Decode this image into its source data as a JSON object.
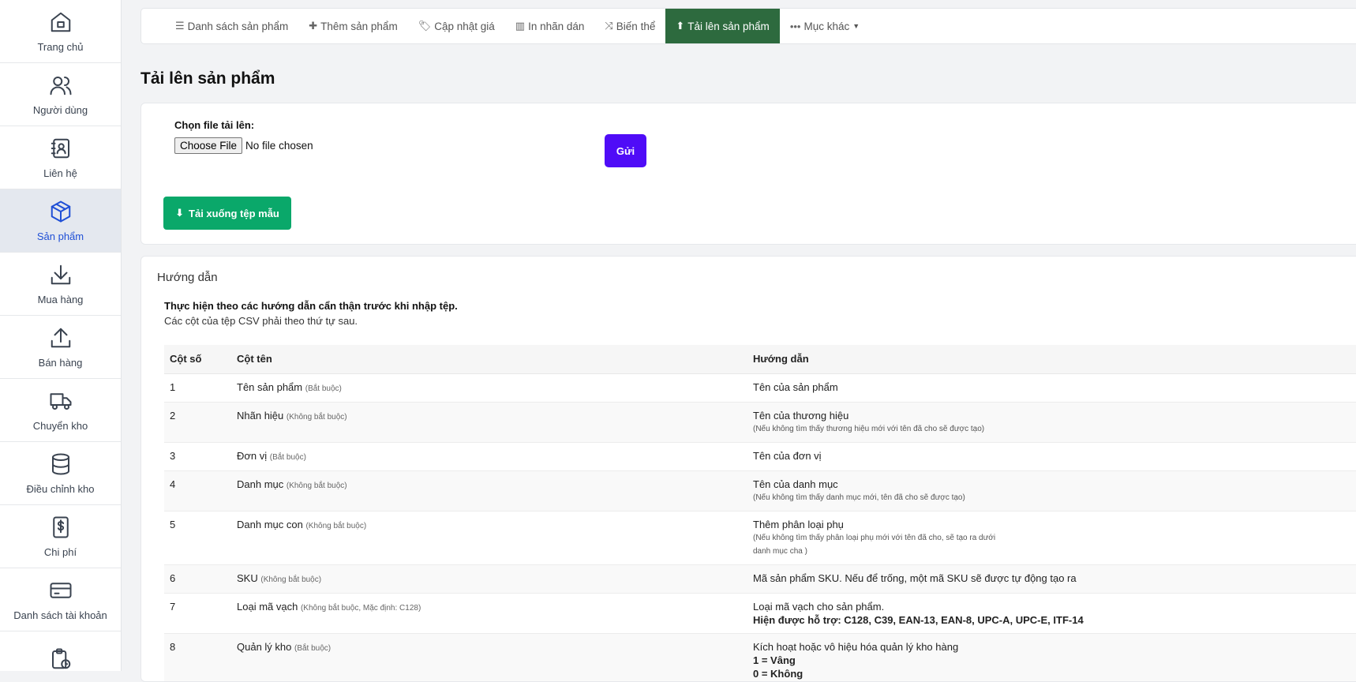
{
  "sidebar": {
    "items": [
      {
        "label": "Trang chủ",
        "icon": "home-icon"
      },
      {
        "label": "Người dùng",
        "icon": "users-icon"
      },
      {
        "label": "Liên hệ",
        "icon": "contact-book-icon"
      },
      {
        "label": "Sản phẩm",
        "icon": "cube-icon",
        "active": true
      },
      {
        "label": "Mua hàng",
        "icon": "download-arrow-icon"
      },
      {
        "label": "Bán hàng",
        "icon": "upload-arrow-icon"
      },
      {
        "label": "Chuyển kho",
        "icon": "truck-icon"
      },
      {
        "label": "Điều chỉnh kho",
        "icon": "database-icon"
      },
      {
        "label": "Chi phí",
        "icon": "dollar-doc-icon"
      },
      {
        "label": "Danh sách tài khoản",
        "icon": "card-icon"
      },
      {
        "label": "",
        "icon": "clipboard-clock-icon"
      }
    ]
  },
  "nav": {
    "items": [
      {
        "label": "Danh sách sản phẩm",
        "icon": "☰"
      },
      {
        "label": "Thêm sản phẩm",
        "icon": "✚"
      },
      {
        "label": "Cập nhật giá",
        "icon": "🏷"
      },
      {
        "label": "In nhãn dán",
        "icon": "▥"
      },
      {
        "label": "Biến thể",
        "icon": "⤨"
      },
      {
        "label": "Tải lên sản phẩm",
        "icon": "⬆",
        "active": true
      },
      {
        "label": "Mục khác",
        "icon": "•••"
      }
    ]
  },
  "page": {
    "title": "Tải lên sản phẩm"
  },
  "upload": {
    "file_label": "Chọn file tải lên:",
    "choose_file": "Choose File",
    "no_file": "No file chosen",
    "send": "Gửi",
    "download_template": "Tải xuống tệp mẫu"
  },
  "guide": {
    "title": "Hướng dẫn",
    "intro": "Thực hiện theo các hướng dẫn cẩn thận trước khi nhập tệp.",
    "sub": "Các cột của tệp CSV phải theo thứ tự sau.",
    "headers": [
      "Cột số",
      "Cột tên",
      "Hướng dẫn"
    ],
    "rows": [
      {
        "no": "1",
        "name": "Tên sản phẩm",
        "req": "(Bắt buộc)",
        "guide": "Tên của sản phẩm",
        "note": "",
        "bold": ""
      },
      {
        "no": "2",
        "name": "Nhãn hiệu",
        "req": "(Không bắt buộc)",
        "guide": "Tên của thương hiệu",
        "note": "(Nếu không tìm thấy thương hiệu mới với tên đã cho sẽ được tạo)",
        "bold": ""
      },
      {
        "no": "3",
        "name": "Đơn vị",
        "req": "(Bắt buộc)",
        "guide": "Tên của đơn vị",
        "note": "",
        "bold": ""
      },
      {
        "no": "4",
        "name": "Danh mục",
        "req": "(Không bắt buộc)",
        "guide": "Tên của danh mục",
        "note": "(Nếu không tìm thấy danh mục mới, tên đã cho sẽ được tạo)",
        "bold": ""
      },
      {
        "no": "5",
        "name": "Danh mục con",
        "req": "(Không bắt buộc)",
        "guide": "Thêm phân loại phụ",
        "note": "(Nếu không tìm thấy phân loại phụ mới với tên đã cho, sẽ tạo ra dưới",
        "note2": "danh mục cha )",
        "bold": ""
      },
      {
        "no": "6",
        "name": "SKU",
        "req": "(Không bắt buộc)",
        "guide": "Mã sản phẩm SKU. Nếu để trống, một mã SKU sẽ được tự động tạo ra",
        "note": "",
        "bold": ""
      },
      {
        "no": "7",
        "name": "Loại mã vạch",
        "req": "(Không bắt buộc, Mặc định: C128)",
        "guide": "Loại mã vạch cho sản phẩm.",
        "note": "",
        "bold": "Hiện được hỗ trợ: C128, C39, EAN-13, EAN-8, UPC-A, UPC-E, ITF-14"
      },
      {
        "no": "8",
        "name": "Quản lý kho",
        "req": "(Bắt buộc)",
        "guide": "Kích hoạt hoặc vô hiệu hóa quản lý kho hàng",
        "note": "",
        "bold": "1 = Vâng",
        "bold2": "0 = Không"
      }
    ]
  }
}
